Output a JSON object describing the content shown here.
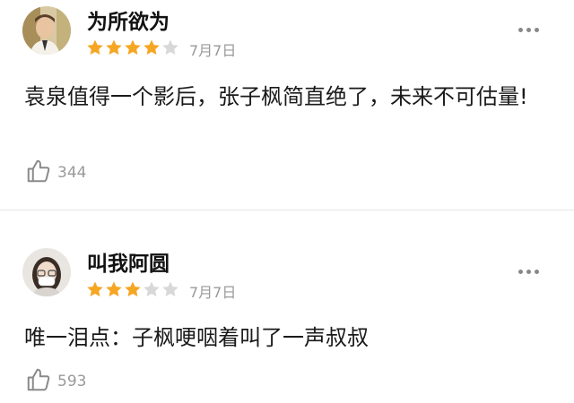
{
  "reviews": [
    {
      "username": "为所欲为",
      "rating": 4,
      "max_rating": 5,
      "date": "7月7日",
      "content": "袁泉值得一个影后，张子枫简直绝了，未来不可估量!",
      "likes": "344",
      "avatar_icon": "avatar-man",
      "more_icon": "more-dots-icon",
      "like_icon": "thumbs-up-icon"
    },
    {
      "username": "叫我阿圆",
      "rating": 3,
      "max_rating": 5,
      "date": "7月7日",
      "content": "唯一泪点：子枫哽咽着叫了一声叔叔",
      "likes": "593",
      "avatar_icon": "avatar-woman",
      "more_icon": "more-dots-icon",
      "like_icon": "thumbs-up-icon"
    }
  ],
  "colors": {
    "star_filled": "#f5a623",
    "star_empty": "#d8d8d8",
    "divider": "#e6e6e6"
  }
}
